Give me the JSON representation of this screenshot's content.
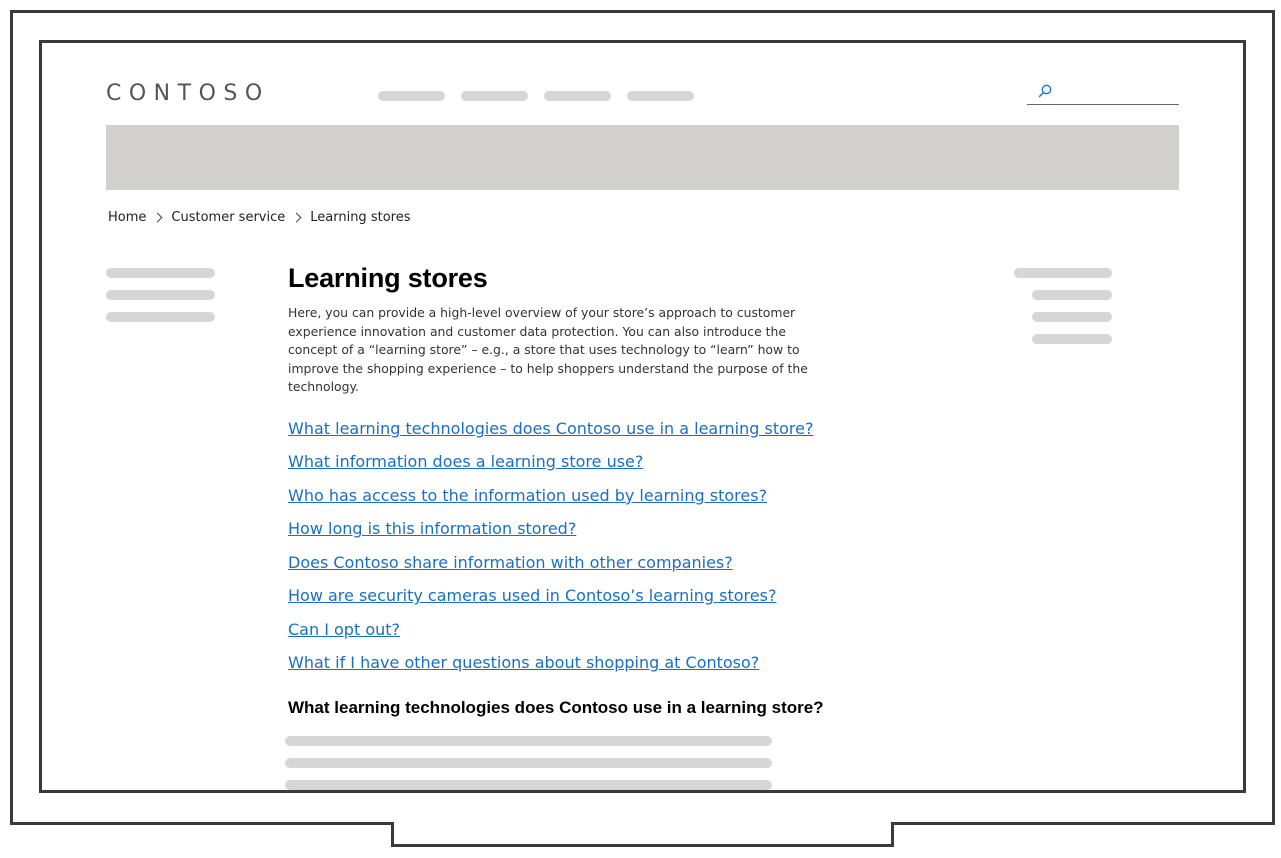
{
  "header": {
    "logo": "CONTOSO",
    "nav_placeholders": 4,
    "search": {
      "placeholder": ""
    }
  },
  "breadcrumb": [
    "Home",
    "Customer service",
    "Learning stores"
  ],
  "main": {
    "title": "Learning stores",
    "intro": "Here, you can provide a high-level overview of your store’s approach to customer experience innovation and customer data protection. You can also introduce the concept of a “learning store” – e.g., a store that uses technology to “learn” how to improve the shopping experience – to help shoppers understand the purpose of the technology.",
    "faq_links": [
      "What learning technologies does Contoso use in a learning store?",
      "What information does a learning store use?",
      "Who has access to the information used by learning stores?",
      "How long is this information stored?",
      "Does Contoso share information with other companies?",
      "How are security cameras used in Contoso’s learning stores?",
      "Can I opt out?",
      "What if I have other questions about shopping at Contoso?"
    ],
    "section_heading": "What learning technologies does Contoso use in a learning store?"
  },
  "colors": {
    "link": "#1a6fc4",
    "placeholder": "#d6d6d6",
    "banner": "#d2d1cf",
    "frame": "#3a3a3a"
  },
  "icons": [
    "search-icon",
    "chevron-right-icon"
  ]
}
